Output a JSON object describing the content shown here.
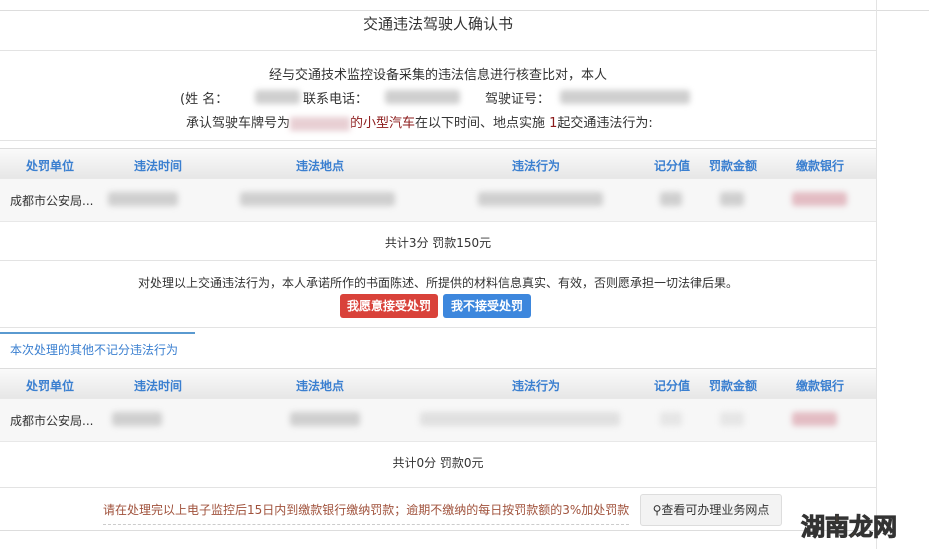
{
  "title": "交通违法驾驶人确认书",
  "intro": {
    "line1": "经与交通技术监控设备采集的违法信息进行核查比对，本人",
    "name_label": "(姓 名：",
    "phone_label": "联系电话：",
    "license_label": "驾驶证号：",
    "plate_prefix": "承认驾驶车牌号为",
    "plate_suffix": "的",
    "vehicle_type": "小型汽车",
    "line3_rest": "在以下时间、地点实施",
    "count": "1",
    "line3_end": "起交通违法行为:"
  },
  "columns": [
    "处罚单位",
    "违法时间",
    "违法地点",
    "违法行为",
    "记分值",
    "罚款金额",
    "缴款银行"
  ],
  "table1": {
    "rows": [
      {
        "unit": "成都市公安局..."
      }
    ],
    "total": "共计3分 罚款150元"
  },
  "promise": "对处理以上交通违法行为，本人承诺所作的书面陈述、所提供的材料信息真实、有效，否则愿承担一切法律后果。",
  "buttons": {
    "accept": "我愿意接受处罚",
    "reject": "我不接受处罚"
  },
  "tab": "本次处理的其他不记分违法行为",
  "table2": {
    "rows": [
      {
        "unit": "成都市公安局..."
      }
    ],
    "total": "共计0分 罚款0元"
  },
  "footer": {
    "note": "请在处理完以上电子监控后15日内到缴款银行缴纳罚款；逾期不缴纳的每日按罚款额的3%加处罚款",
    "network_button": "查看可办理业务网点",
    "network_icon": "map-marker-icon"
  },
  "watermark": "湖南龙网",
  "colors": {
    "accent": "#3a7fd0",
    "accept": "#d9423a",
    "reject": "#3d87dd",
    "note": "#a0523c"
  }
}
